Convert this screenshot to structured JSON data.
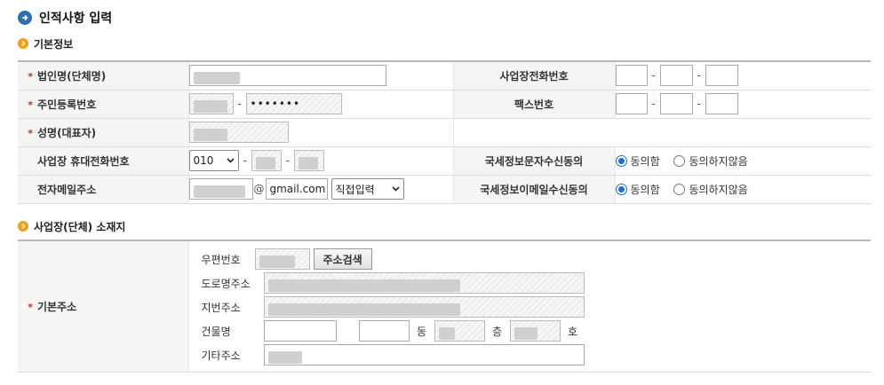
{
  "page": {
    "title": "인적사항 입력"
  },
  "sections": {
    "basic": {
      "title": "기본정보"
    },
    "address": {
      "title": "사업장(단체) 소재지"
    }
  },
  "basic": {
    "company_name": {
      "label": "법인명(단체명)",
      "required": "*"
    },
    "resident_no": {
      "label": "주민등록번호",
      "required": "*",
      "masked": "•••••••"
    },
    "ceo_name": {
      "label": "성명(대표자)",
      "required": "*"
    },
    "mobile": {
      "label": "사업장 휴대전화번호",
      "prefix": "010"
    },
    "email": {
      "label": "전자메일주소",
      "at": "@",
      "domain": "gmail.com",
      "domain_select": "직접입력"
    },
    "biz_phone": {
      "label": "사업장전화번호"
    },
    "fax": {
      "label": "팩스번호"
    },
    "sms_consent": {
      "label": "국세정보문자수신동의",
      "options": [
        "동의함",
        "동의하지않음"
      ],
      "selected": "동의함"
    },
    "email_consent": {
      "label": "국세정보이메일수신동의",
      "options": [
        "동의함",
        "동의하지않음"
      ],
      "selected": "동의함"
    },
    "dash": "-"
  },
  "address": {
    "label": "기본주소",
    "required": "*",
    "postcode": {
      "label": "우편번호"
    },
    "search_button": "주소검색",
    "road": {
      "label": "도로명주소"
    },
    "lot": {
      "label": "지번주소"
    },
    "building": {
      "label": "건물명",
      "dong_unit": "동",
      "floor_unit": "층",
      "ho_unit": "호"
    },
    "extra": {
      "label": "기타주소"
    }
  },
  "colors": {
    "required": "#d4232a",
    "radio": "#1a6fd6",
    "title_icon": "#2f6fa9",
    "bullet": "#f0a016"
  }
}
